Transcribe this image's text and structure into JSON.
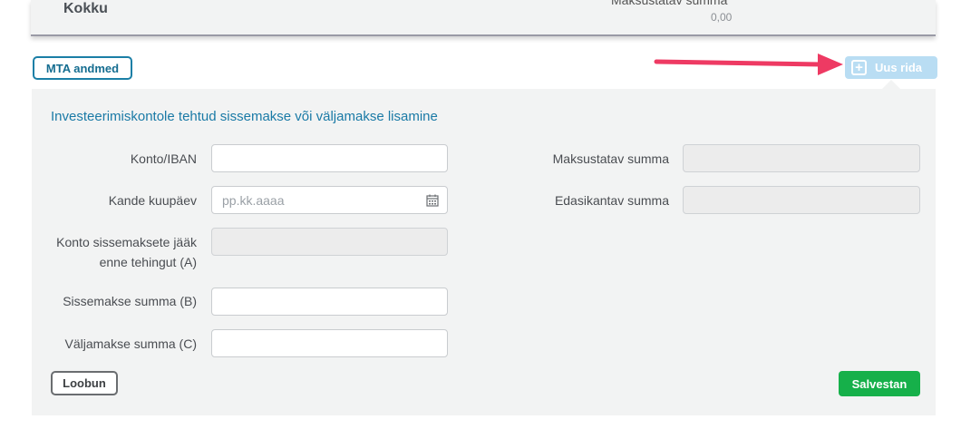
{
  "summary": {
    "total_label": "Kokku",
    "taxable_sum_label": "Maksustatav summa",
    "taxable_sum_value": "0,00"
  },
  "toolbar": {
    "mta_label": "MTA andmed",
    "add_row_label": "Uus rida"
  },
  "form": {
    "title": "Investeerimiskontole tehtud sissemakse või väljamakse lisamine",
    "fields": {
      "account_label": "Konto/IBAN",
      "account_value": "",
      "entry_date_label": "Kande kuupäev",
      "entry_date_placeholder": "pp.kk.aaaa",
      "balance_label_line1": "Konto sissemaksete jääk",
      "balance_label_line2": "enne tehingut (A)",
      "balance_value": "",
      "deposit_label": "Sissemakse summa (B)",
      "deposit_value": "",
      "withdrawal_label": "Väljamakse summa (C)",
      "withdrawal_value": "",
      "taxable_label": "Maksustatav summa",
      "taxable_value": "",
      "carryover_label": "Edasikantav summa",
      "carryover_value": ""
    },
    "cancel_label": "Loobun",
    "save_label": "Salvestan"
  },
  "colors": {
    "accent": "#1a7aa6",
    "save_green": "#16b04a",
    "add_row_bg": "#b9ddf3",
    "arrow": "#ee3a63"
  }
}
